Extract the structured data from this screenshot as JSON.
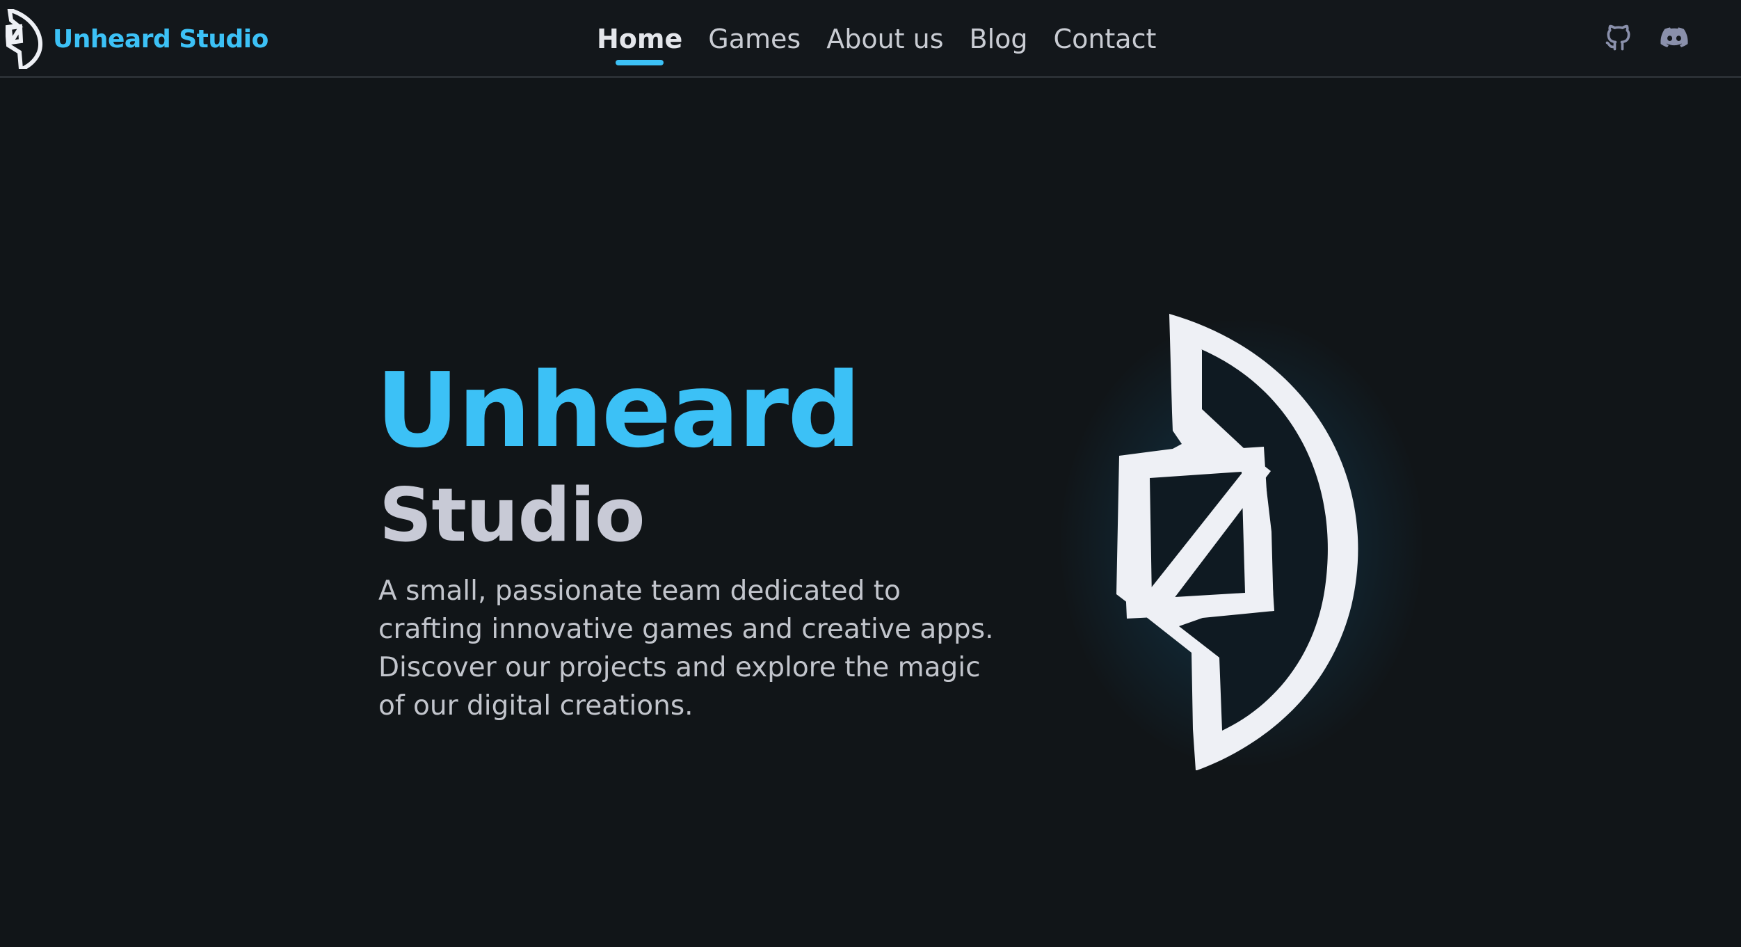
{
  "brand": {
    "name": "Unheard Studio",
    "logo_icon": "unheard-studio-logo"
  },
  "nav": {
    "items": [
      {
        "label": "Home",
        "active": true
      },
      {
        "label": "Games",
        "active": false
      },
      {
        "label": "About us",
        "active": false
      },
      {
        "label": "Blog",
        "active": false
      },
      {
        "label": "Contact",
        "active": false
      }
    ]
  },
  "social": {
    "github_icon": "github-icon",
    "discord_icon": "discord-icon"
  },
  "hero": {
    "title": "Unheard",
    "subtitle": "Studio",
    "description": "A small, passionate team dedicated to crafting innovative games and creative apps. Discover our projects and explore the magic of our digital creations."
  },
  "colors": {
    "background": "#111518",
    "navbar": "#13171b",
    "accent": "#3cc1f6",
    "text": "#c9ccd3",
    "logo": "#eef0f5"
  }
}
